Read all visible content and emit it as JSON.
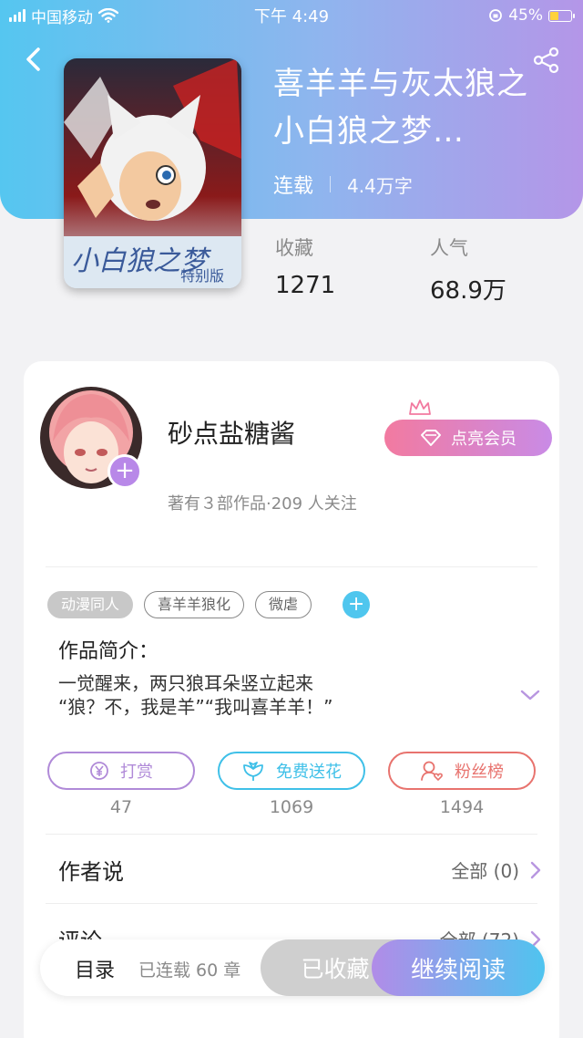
{
  "status_bar": {
    "carrier": "中国移动",
    "time": "下午 4:49",
    "battery": "45%",
    "battery_level": 0.45
  },
  "book": {
    "title": "喜羊羊与灰太狼之小白狼之梦…",
    "status": "连载",
    "word_count": "4.4万字",
    "cover_text": "小白狼之梦",
    "cover_subtext": "特别版"
  },
  "stats": [
    {
      "label": "收藏",
      "value": "1271"
    },
    {
      "label": "人气",
      "value": "68.9万"
    }
  ],
  "author": {
    "name": "砂点盐糖酱",
    "subtitle": "著有３部作品·209 人关注",
    "vip_button": "点亮会员"
  },
  "tags": [
    "动漫同人",
    "喜羊羊狼化",
    "微虐"
  ],
  "intro": {
    "heading": "作品简介：",
    "line1": "一觉醒来，两只狼耳朵竖立起来",
    "line2": "“狼？不，我是羊”“我叫喜羊羊！”"
  },
  "actions": [
    {
      "label": "打赏",
      "count": "47",
      "color": "#b08ad8",
      "icon": "yen-coin-icon"
    },
    {
      "label": "免费送花",
      "count": "1069",
      "color": "#3fc0e8",
      "icon": "flower-icon"
    },
    {
      "label": "粉丝榜",
      "count": "1494",
      "color": "#e8736e",
      "icon": "fan-user-icon"
    }
  ],
  "sections": [
    {
      "heading": "作者说",
      "link": "全部 (0)"
    },
    {
      "heading": "评论",
      "link": "全部 (72)"
    }
  ],
  "bottom": {
    "toc": "目录",
    "chapters": "已连载 60 章",
    "collected": "已收藏",
    "continue": "继续阅读"
  }
}
